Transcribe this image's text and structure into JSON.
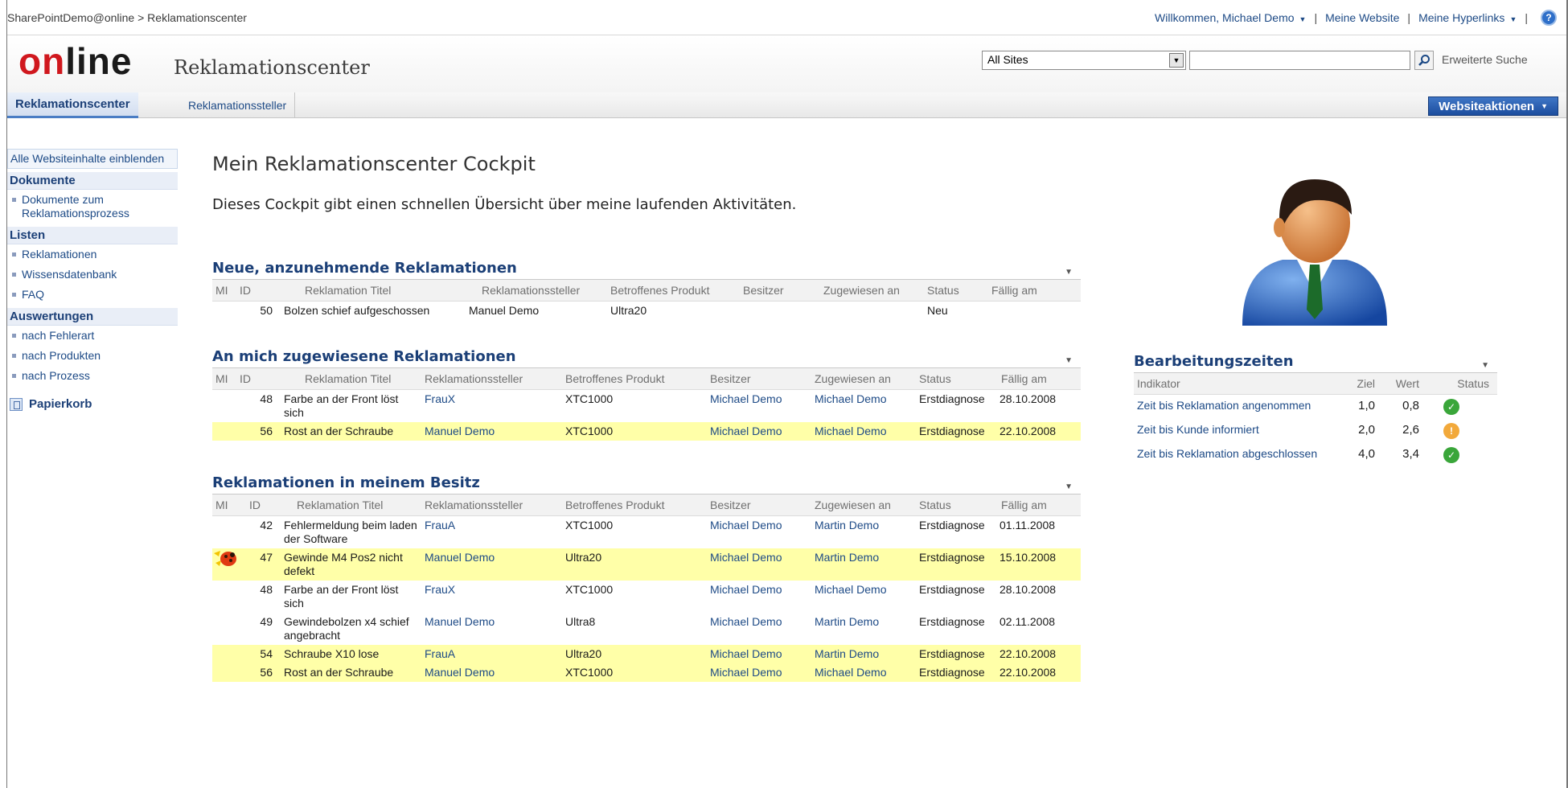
{
  "topbar": {
    "breadcrumb_site": "SharePointDemo@online",
    "breadcrumb_sep": ">",
    "breadcrumb_page": "Reklamationscenter",
    "welcome": "Willkommen, Michael Demo",
    "my_site": "Meine Website",
    "my_links": "Meine Hyperlinks",
    "sep": "|",
    "help": "?"
  },
  "header": {
    "logo_part1": "on",
    "logo_part2": "line",
    "site_title": "Reklamationscenter",
    "scope_value": "All Sites",
    "search_value": "",
    "advanced_search": "Erweiterte Suche"
  },
  "nav": {
    "active_tab": "Reklamationscenter",
    "tab2": "Reklamationssteller",
    "site_actions": "Websiteaktionen"
  },
  "quicklaunch": {
    "all_content": "Alle Websiteinhalte einblenden",
    "sections": [
      {
        "heading": "Dokumente",
        "items": [
          "Dokumente zum Reklamationsprozess"
        ]
      },
      {
        "heading": "Listen",
        "items": [
          "Reklamationen",
          "Wissensdatenbank",
          "FAQ"
        ]
      },
      {
        "heading": "Auswertungen",
        "items": [
          "nach Fehlerart",
          "nach Produkten",
          "nach Prozess"
        ]
      }
    ],
    "recycle_bin": "Papierkorb"
  },
  "main": {
    "title": "Mein Reklamationscenter Cockpit",
    "description": "Dieses Cockpit gibt einen schnellen Übersicht über meine laufenden Aktivitäten."
  },
  "columns": {
    "mi": "MI",
    "id": "ID",
    "title": "Reklamation Titel",
    "reporter": "Reklamationssteller",
    "product": "Betroffenes Produkt",
    "owner": "Besitzer",
    "assigned": "Zugewiesen an",
    "status": "Status",
    "due": "Fällig am"
  },
  "wp1": {
    "title": "Neue, anzunehmende Reklamationen",
    "rows": [
      {
        "id": "50",
        "title": "Bolzen schief aufgeschossen",
        "reporter": "Manuel Demo",
        "product": "Ultra20",
        "owner": "",
        "assigned": "",
        "status": "Neu",
        "due": ""
      }
    ]
  },
  "wp2": {
    "title": "An mich zugewiesene Reklamationen",
    "rows": [
      {
        "id": "48",
        "title": "Farbe an der Front löst sich",
        "reporter": "FrauX",
        "product": "XTC1000",
        "owner": "Michael Demo",
        "assigned": "Michael Demo",
        "status": "Erstdiagnose",
        "due": "28.10.2008"
      },
      {
        "id": "56",
        "title": "Rost an der Schraube",
        "reporter": "Manuel Demo",
        "product": "XTC1000",
        "owner": "Michael Demo",
        "assigned": "Michael Demo",
        "status": "Erstdiagnose",
        "due": "22.10.2008"
      }
    ]
  },
  "wp3": {
    "title": "Reklamationen in meinem Besitz",
    "rows": [
      {
        "id": "42",
        "title": "Fehlermeldung beim laden der Software",
        "reporter": "FrauA",
        "product": "XTC1000",
        "owner": "Michael Demo",
        "assigned": "Martin Demo",
        "status": "Erstdiagnose",
        "due": "01.11.2008"
      },
      {
        "id": "47",
        "title": "Gewinde M4 Pos2 nicht defekt",
        "reporter": "Manuel Demo",
        "product": "Ultra20",
        "owner": "Michael Demo",
        "assigned": "Martin Demo",
        "status": "Erstdiagnose",
        "due": "15.10.2008"
      },
      {
        "id": "48",
        "title": "Farbe an der Front löst sich",
        "reporter": "FrauX",
        "product": "XTC1000",
        "owner": "Michael Demo",
        "assigned": "Michael Demo",
        "status": "Erstdiagnose",
        "due": "28.10.2008"
      },
      {
        "id": "49",
        "title": "Gewindebolzen x4 schief angebracht",
        "reporter": "Manuel Demo",
        "product": "Ultra8",
        "owner": "Michael Demo",
        "assigned": "Martin Demo",
        "status": "Erstdiagnose",
        "due": "02.11.2008"
      },
      {
        "id": "54",
        "title": "Schraube X10 lose",
        "reporter": "FrauA",
        "product": "Ultra20",
        "owner": "Michael Demo",
        "assigned": "Martin Demo",
        "status": "Erstdiagnose",
        "due": "22.10.2008"
      },
      {
        "id": "56",
        "title": "Rost an der Schraube",
        "reporter": "Manuel Demo",
        "product": "XTC1000",
        "owner": "Michael Demo",
        "assigned": "Michael Demo",
        "status": "Erstdiagnose",
        "due": "22.10.2008"
      }
    ]
  },
  "kpi": {
    "title": "Bearbeitungszeiten",
    "col_indicator": "Indikator",
    "col_target": "Ziel",
    "col_value": "Wert",
    "col_status": "Status",
    "rows": [
      {
        "indicator": "Zeit bis Reklamation angenommen",
        "target": "1,0",
        "value": "0,8",
        "status": "ok"
      },
      {
        "indicator": "Zeit bis Kunde informiert",
        "target": "2,0",
        "value": "2,6",
        "status": "warning"
      },
      {
        "indicator": "Zeit bis Reklamation abgeschlossen",
        "target": "4,0",
        "value": "3,4",
        "status": "ok"
      }
    ]
  },
  "colors": {
    "link": "#1d4a86",
    "heading": "#1b3f77",
    "highlight": "#ffffa8",
    "logo_red": "#d0181e",
    "status_ok": "#3aa63a",
    "status_warning": "#f2a93b"
  }
}
